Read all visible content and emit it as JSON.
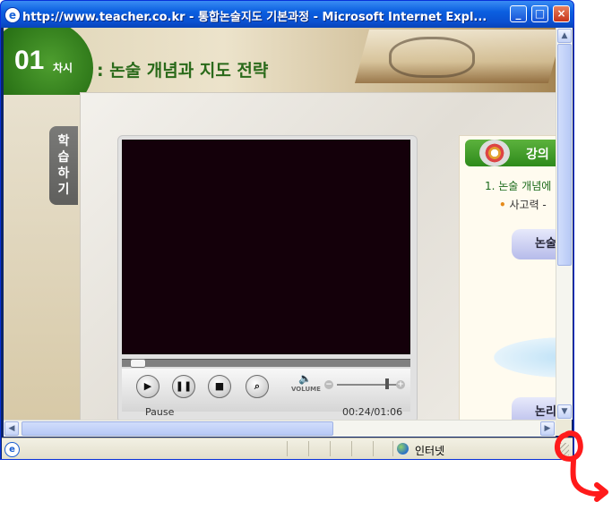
{
  "window": {
    "title": "http://www.teacher.co.kr - 통합논술지도 기본과정 - Microsoft Internet Expl...",
    "app_icon": "ie-icon",
    "controls": {
      "minimize": "_",
      "maximize": "□",
      "close": "×"
    }
  },
  "lesson": {
    "number": "01",
    "number_suffix": "차시",
    "title": ": 논술 개념과 지도 전략"
  },
  "study_tab": {
    "chars": [
      "학",
      "습",
      "하",
      "기"
    ]
  },
  "player": {
    "status": "Pause",
    "time": "00:24/01:06",
    "volume_label": "VOLUME",
    "progress_fraction": 0.02,
    "volume_fraction": 0.8,
    "buttons": {
      "play": "▶",
      "pause": "❚❚",
      "stop": "■",
      "zoom": "⌕"
    },
    "vol_minus": "−",
    "vol_plus": "+"
  },
  "lecture_panel": {
    "header": "강의",
    "toc_item_1": "1. 논술 개념에",
    "toc_sub_bullet": "•",
    "toc_sub_1": "사고력 -",
    "button_1": "논술",
    "button_2": "논리"
  },
  "statusbar": {
    "zone": "인터넷"
  },
  "colors": {
    "annotation": "#ff1a1a",
    "accent_green": "#2e8a1b",
    "title_blue": "#0a4fd0"
  }
}
